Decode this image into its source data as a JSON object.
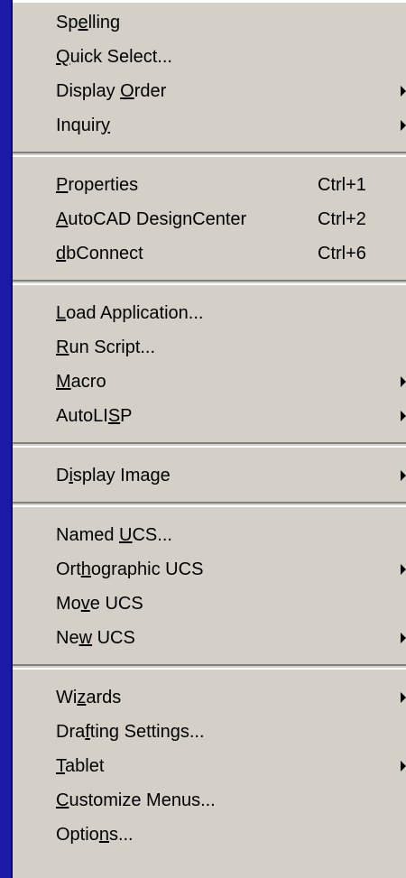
{
  "menu": {
    "groups": [
      {
        "items": [
          {
            "pre": "Sp",
            "acc": "e",
            "post": "lling",
            "shortcut": "",
            "submenu": false
          },
          {
            "pre": "",
            "acc": "Q",
            "post": "uick Select...",
            "shortcut": "",
            "submenu": false
          },
          {
            "pre": "Display ",
            "acc": "O",
            "post": "rder",
            "shortcut": "",
            "submenu": true
          },
          {
            "pre": "Inquir",
            "acc": "y",
            "post": "",
            "shortcut": "",
            "submenu": true
          }
        ]
      },
      {
        "items": [
          {
            "pre": "",
            "acc": "P",
            "post": "roperties",
            "shortcut": "Ctrl+1",
            "submenu": false
          },
          {
            "pre": "",
            "acc": "A",
            "post": "utoCAD DesignCenter",
            "shortcut": "Ctrl+2",
            "submenu": false
          },
          {
            "pre": "",
            "acc": "d",
            "post": "bConnect",
            "shortcut": "Ctrl+6",
            "submenu": false
          }
        ]
      },
      {
        "items": [
          {
            "pre": "",
            "acc": "L",
            "post": "oad Application...",
            "shortcut": "",
            "submenu": false
          },
          {
            "pre": "",
            "acc": "R",
            "post": "un Script...",
            "shortcut": "",
            "submenu": false
          },
          {
            "pre": "",
            "acc": "M",
            "post": "acro",
            "shortcut": "",
            "submenu": true
          },
          {
            "pre": "AutoLI",
            "acc": "S",
            "post": "P",
            "shortcut": "",
            "submenu": true
          }
        ]
      },
      {
        "items": [
          {
            "pre": "D",
            "acc": "i",
            "post": "splay Image",
            "shortcut": "",
            "submenu": true
          }
        ]
      },
      {
        "items": [
          {
            "pre": "Named ",
            "acc": "U",
            "post": "CS...",
            "shortcut": "",
            "submenu": false
          },
          {
            "pre": "Ort",
            "acc": "h",
            "post": "ographic UCS",
            "shortcut": "",
            "submenu": true
          },
          {
            "pre": "Mo",
            "acc": "v",
            "post": "e UCS",
            "shortcut": "",
            "submenu": false
          },
          {
            "pre": "Ne",
            "acc": "w",
            "post": " UCS",
            "shortcut": "",
            "submenu": true
          }
        ]
      },
      {
        "items": [
          {
            "pre": "Wi",
            "acc": "z",
            "post": "ards",
            "shortcut": "",
            "submenu": true
          },
          {
            "pre": "Dra",
            "acc": "f",
            "post": "ting Settings...",
            "shortcut": "",
            "submenu": false
          },
          {
            "pre": "",
            "acc": "T",
            "post": "ablet",
            "shortcut": "",
            "submenu": true
          },
          {
            "pre": "",
            "acc": "C",
            "post": "ustomize Menus...",
            "shortcut": "",
            "submenu": false
          },
          {
            "pre": "Optio",
            "acc": "n",
            "post": "s...",
            "shortcut": "",
            "submenu": false
          }
        ]
      }
    ]
  }
}
